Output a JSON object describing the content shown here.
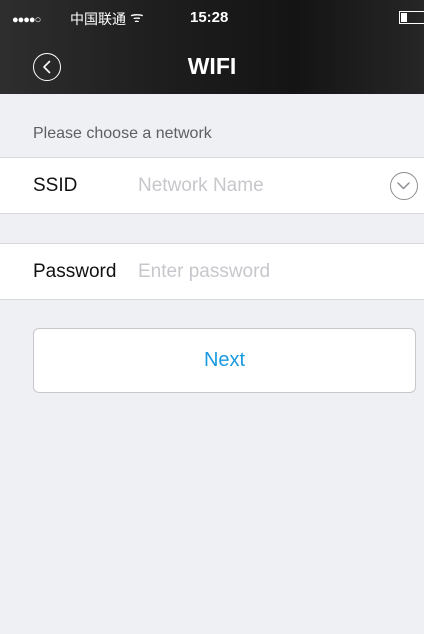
{
  "status_bar": {
    "signal": "●●●●○",
    "carrier": "中国联通",
    "wifi_symbol": "ᯤ",
    "time": "15:28",
    "battery_level": 0.25
  },
  "header": {
    "title": "WIFI",
    "back_icon": "chevron-left-circle-icon"
  },
  "form": {
    "section_label": "Please choose a network",
    "ssid": {
      "label": "SSID",
      "value": "",
      "placeholder": "Network Name",
      "dropdown_icon": "chevron-down-circle-icon"
    },
    "password": {
      "label": "Password",
      "value": "",
      "placeholder": "Enter password"
    },
    "next_label": "Next"
  },
  "colors": {
    "header_bg": "#1d1d1d",
    "page_bg": "#eff0f4",
    "accent": "#1a9ae0",
    "placeholder": "#c7c7cc"
  }
}
